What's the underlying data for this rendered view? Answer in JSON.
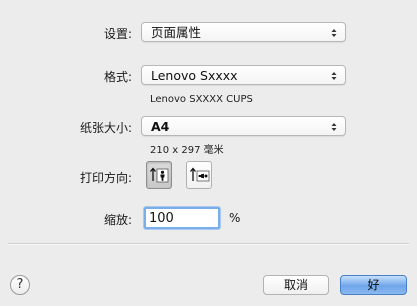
{
  "settings": {
    "label": "设置:",
    "value": "页面属性"
  },
  "format": {
    "label": "格式:",
    "value": "Lenovo Sxxxx",
    "printer_detail": "Lenovo SXXXX CUPS"
  },
  "paper_size": {
    "label": "纸张大小:",
    "value": "A4",
    "dimensions": "210 x 297 毫米"
  },
  "orientation": {
    "label": "打印方向:",
    "options": [
      "portrait",
      "landscape"
    ],
    "selected": "portrait"
  },
  "scale": {
    "label": "缩放:",
    "value": "100",
    "unit": "%"
  },
  "buttons": {
    "help": "?",
    "cancel": "取消",
    "ok": "好"
  }
}
